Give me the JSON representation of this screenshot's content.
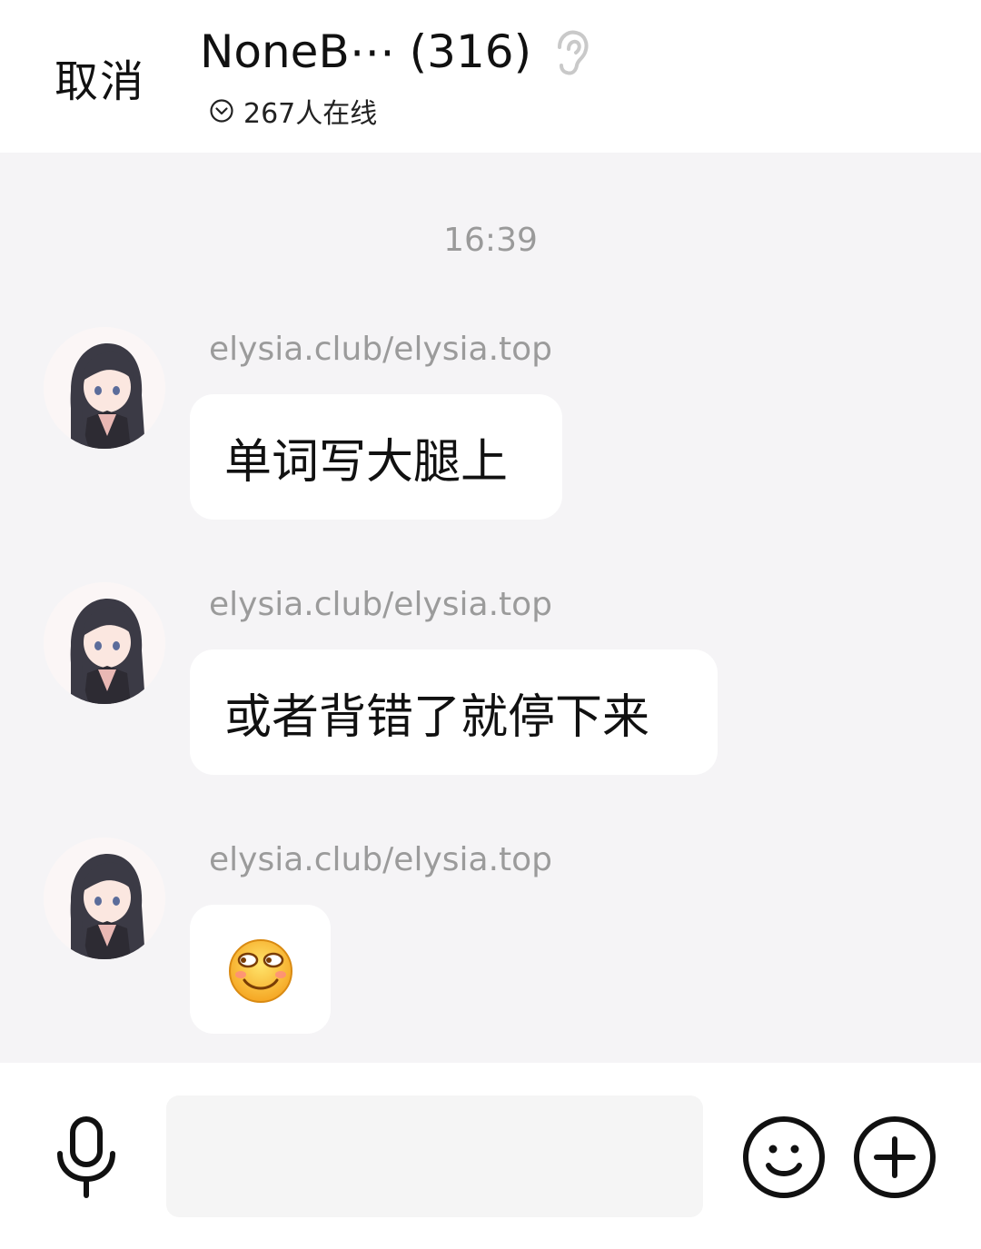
{
  "header": {
    "cancel_label": "取消",
    "group_name": "NoneB⋯",
    "member_count": "(316)",
    "online_text": "267人在线",
    "ear_icon": "ear-icon",
    "chevron_icon": "chevron-down-circle-icon"
  },
  "chat": {
    "timestamp": "16:39",
    "messages": [
      {
        "sender": "elysia.club/elysia.top",
        "text": "单词写大腿上",
        "type": "text"
      },
      {
        "sender": "elysia.club/elysia.top",
        "text": "或者背错了就停下来",
        "type": "text"
      },
      {
        "sender": "elysia.club/elysia.top",
        "text": "",
        "type": "emoji",
        "emoji": "smirk-face-emoji"
      }
    ]
  },
  "input_bar": {
    "placeholder": "",
    "value": "",
    "mic_icon": "microphone-icon",
    "emoji_icon": "smiley-face-icon",
    "plus_icon": "plus-circle-icon"
  },
  "colors": {
    "header_bg": "#ffffff",
    "chat_bg": "#f5f4f6",
    "bubble_bg": "#ffffff",
    "sender_text": "#9b9b9b",
    "timestamp_text": "#9a9a9a",
    "primary_text": "#111111",
    "input_bg": "#f5f5f5"
  }
}
